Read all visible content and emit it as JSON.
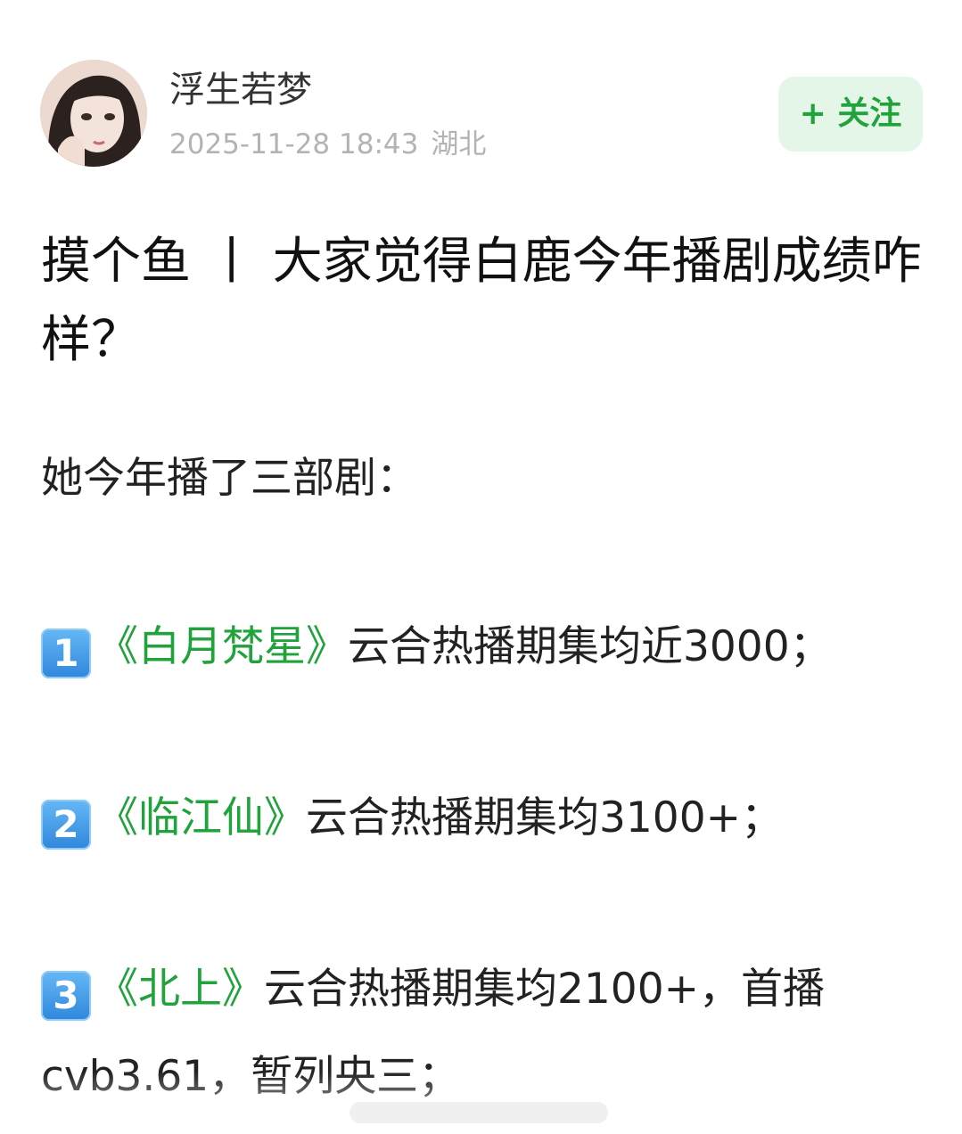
{
  "author": {
    "name": "浮生若梦",
    "timestamp": "2025-11-28 18:43",
    "location": "湖北",
    "avatar_icon": "avatar-portrait-icon"
  },
  "follow_button": {
    "label": "+ 关注",
    "text_color": "#1fa33a",
    "bg_color": "#e4f6e8"
  },
  "post": {
    "title": "摸个鱼 丨 大家觉得白鹿今年播剧成绩咋样？",
    "intro": "她今年播了三部剧：",
    "items": [
      {
        "num_icon": "keycap-1-icon",
        "num": "1",
        "drama": "《白月梵星》",
        "text": "云合热播期集均近3000；"
      },
      {
        "num_icon": "keycap-2-icon",
        "num": "2",
        "drama": "《临江仙》",
        "text": "云合热播期集均3100+；"
      },
      {
        "num_icon": "keycap-3-icon",
        "num": "3",
        "drama": "《北上》",
        "text": "云合热播期集均2100+，首播",
        "continuation": "cvb3.61，暂列央三；"
      }
    ]
  },
  "colors": {
    "accent": "#1fa33a",
    "meta_gray": "#b3b3b3"
  }
}
